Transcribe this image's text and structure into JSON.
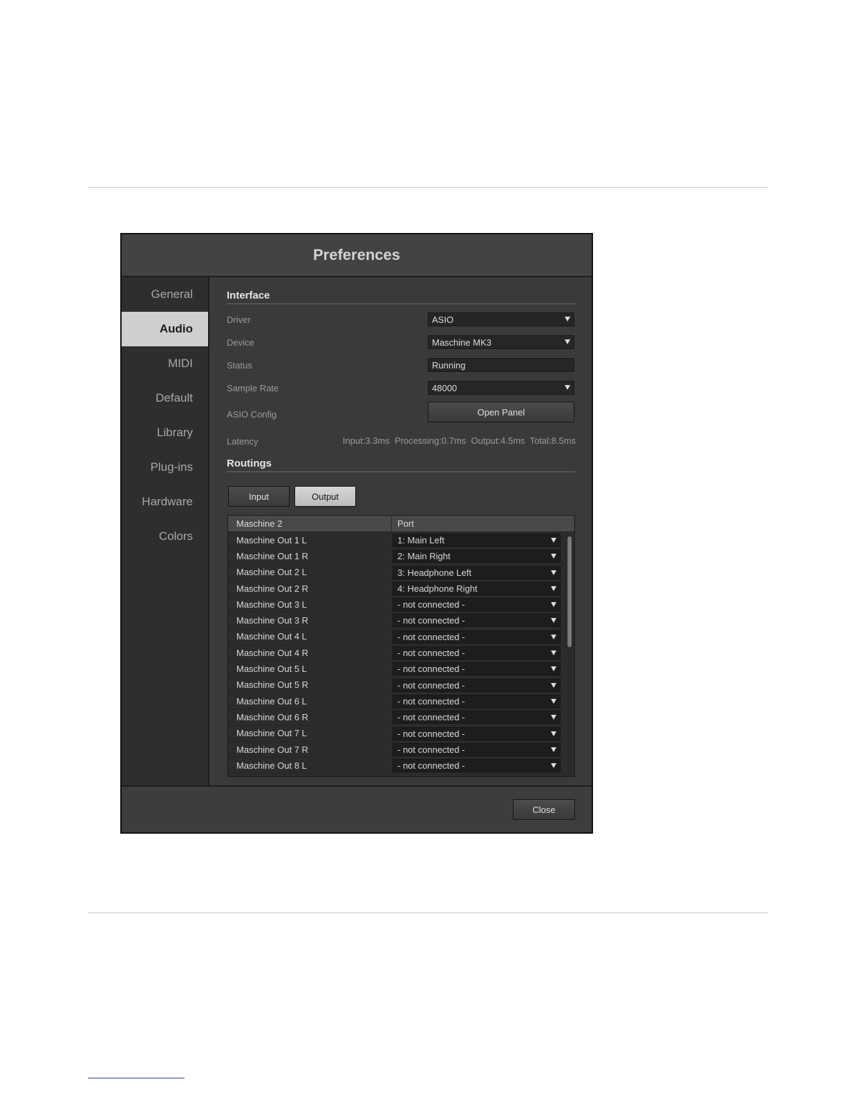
{
  "dialog": {
    "title": "Preferences",
    "close_label": "Close"
  },
  "sidebar": {
    "items": [
      {
        "label": "General"
      },
      {
        "label": "Audio"
      },
      {
        "label": "MIDI"
      },
      {
        "label": "Default"
      },
      {
        "label": "Library"
      },
      {
        "label": "Plug-ins"
      },
      {
        "label": "Hardware"
      },
      {
        "label": "Colors"
      }
    ],
    "active": "Audio"
  },
  "interface": {
    "heading": "Interface",
    "driver_label": "Driver",
    "driver_value": "ASIO",
    "device_label": "Device",
    "device_value": "Maschine MK3",
    "status_label": "Status",
    "status_value": "Running",
    "sample_rate_label": "Sample Rate",
    "sample_rate_value": "48000",
    "asio_config_label": "ASIO Config",
    "open_panel_label": "Open Panel",
    "latency_label": "Latency",
    "latency_values": "Input:3.3ms  Processing:0.7ms  Output:4.5ms  Total:8.5ms"
  },
  "routings": {
    "heading": "Routings",
    "input_tab": "Input",
    "output_tab": "Output",
    "active_tab": "Output",
    "col_name": "Maschine 2",
    "col_port": "Port",
    "rows": [
      {
        "name": "Maschine Out 1 L",
        "port": "1: Main Left"
      },
      {
        "name": "Maschine Out 1 R",
        "port": "2: Main Right"
      },
      {
        "name": "Maschine Out 2 L",
        "port": "3: Headphone Left"
      },
      {
        "name": "Maschine Out 2 R",
        "port": "4: Headphone Right"
      },
      {
        "name": "Maschine Out 3 L",
        "port": "- not connected -"
      },
      {
        "name": "Maschine Out 3 R",
        "port": "- not connected -"
      },
      {
        "name": "Maschine Out 4 L",
        "port": "- not connected -"
      },
      {
        "name": "Maschine Out 4 R",
        "port": "- not connected -"
      },
      {
        "name": "Maschine Out 5 L",
        "port": "- not connected -"
      },
      {
        "name": "Maschine Out 5 R",
        "port": "- not connected -"
      },
      {
        "name": "Maschine Out 6 L",
        "port": "- not connected -"
      },
      {
        "name": "Maschine Out 6 R",
        "port": "- not connected -"
      },
      {
        "name": "Maschine Out 7 L",
        "port": "- not connected -"
      },
      {
        "name": "Maschine Out 7 R",
        "port": "- not connected -"
      },
      {
        "name": "Maschine Out 8 L",
        "port": "- not connected -"
      }
    ]
  },
  "colors": {
    "dialog_bg": "#3a3a3a",
    "sidebar_bg": "#2e2e2e",
    "active_nav_bg": "#cfcfcf",
    "combo_bg": "#262626"
  }
}
